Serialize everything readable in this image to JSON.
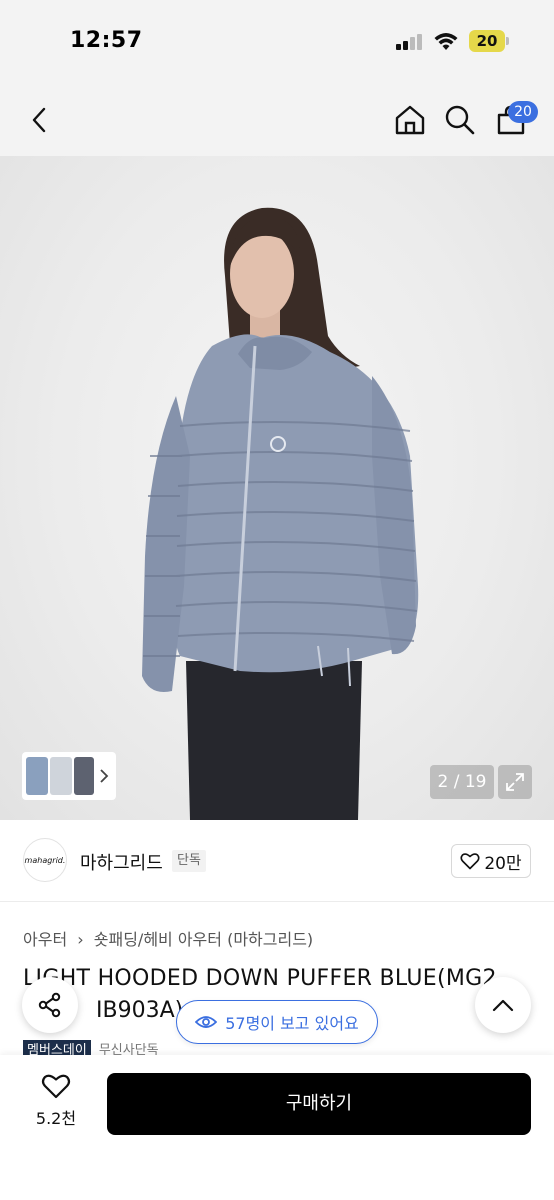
{
  "status": {
    "time": "12:57",
    "battery": "20"
  },
  "nav": {
    "cart_count": "20"
  },
  "gallery": {
    "counter": "2 / 19"
  },
  "brand": {
    "logo_text": "mahagrid.",
    "name": "마하그리드",
    "exclusive": "단독",
    "likes": "20만"
  },
  "breadcrumb": {
    "level1": "아우터",
    "level2": "숏패딩/헤비 아우터 (마하그리드)"
  },
  "product": {
    "title_line1": "LIGHT HOODED DOWN PUFFER BLUE(MG2",
    "title_line2": "IB903A)",
    "tag_member": "멤버스데이",
    "tag_exclusive": "무신사단독"
  },
  "viewers": {
    "text": "57명이 보고 있어요"
  },
  "bottom": {
    "like_count": "5.2천",
    "buy_label": "구매하기"
  },
  "colors": {
    "accent": "#3b6fe0",
    "jacket": "#8e9bb3",
    "button": "#000000"
  }
}
